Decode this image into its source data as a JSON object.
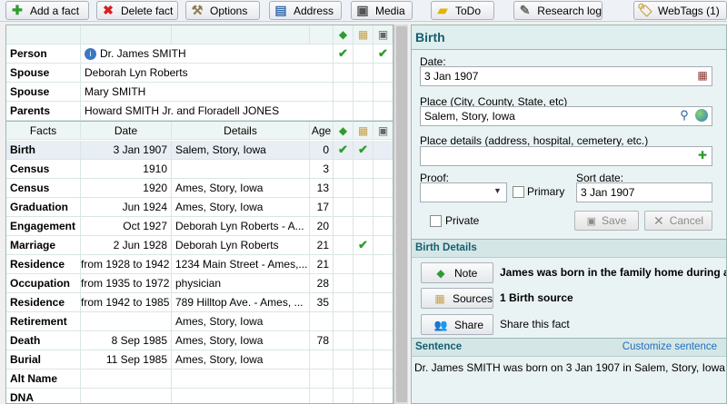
{
  "toolbar": {
    "add_fact": "Add a fact",
    "delete_fact": "Delete fact",
    "options": "Options",
    "address": "Address",
    "media": "Media",
    "todo": "ToDo",
    "research_log": "Research log",
    "webtags": "WebTags (1)"
  },
  "people": {
    "person_label": "Person",
    "person_name": "Dr. James SMITH",
    "spouse1_label": "Spouse",
    "spouse1_name": "Deborah Lyn Roberts",
    "spouse2_label": "Spouse",
    "spouse2_name": "Mary SMITH",
    "parents_label": "Parents",
    "parents_name": "Howard SMITH Jr. and Floradell JONES"
  },
  "facts_header": {
    "facts": "Facts",
    "date": "Date",
    "details": "Details",
    "age": "Age"
  },
  "facts": [
    {
      "fact": "Birth",
      "date": "3 Jan 1907",
      "details": "Salem, Story, Iowa",
      "age": "0",
      "note": true,
      "source": true
    },
    {
      "fact": "Census",
      "date": "1910",
      "details": "",
      "age": "3"
    },
    {
      "fact": "Census",
      "date": "1920",
      "details": "Ames, Story, Iowa",
      "age": "13"
    },
    {
      "fact": "Graduation",
      "date": "Jun 1924",
      "details": "Ames, Story, Iowa",
      "age": "17"
    },
    {
      "fact": "Engagement",
      "date": "Oct 1927",
      "details": "Deborah Lyn Roberts - A...",
      "age": "20"
    },
    {
      "fact": "Marriage",
      "date": "2 Jun 1928",
      "details": "Deborah Lyn Roberts",
      "age": "21",
      "source": true
    },
    {
      "fact": "Residence",
      "date": "from 1928 to 1942",
      "details": "1234 Main Street - Ames,...",
      "age": "21"
    },
    {
      "fact": "Occupation",
      "date": "from 1935 to 1972",
      "details": "physician",
      "age": "28"
    },
    {
      "fact": "Residence",
      "date": "from 1942 to 1985",
      "details": "789 Hilltop Ave. - Ames, ...",
      "age": "35"
    },
    {
      "fact": "Retirement",
      "date": "",
      "details": "Ames, Story, Iowa",
      "age": ""
    },
    {
      "fact": "Death",
      "date": "8 Sep 1985",
      "details": "Ames, Story, Iowa",
      "age": "78"
    },
    {
      "fact": "Burial",
      "date": "11 Sep 1985",
      "details": "Ames, Story, Iowa",
      "age": ""
    },
    {
      "fact": "Alt Name",
      "date": "",
      "details": "",
      "age": ""
    },
    {
      "fact": "DNA",
      "date": "",
      "details": "",
      "age": ""
    }
  ],
  "editor": {
    "title": "Birth",
    "date_label": "Date:",
    "date_value": "3 Jan 1907",
    "place_label": "Place (City, County, State, etc)",
    "place_value": "Salem, Story, Iowa",
    "place_details_label": "Place details (address, hospital, cemetery, etc.)",
    "place_details_value": "",
    "proof_label": "Proof:",
    "proof_value": "",
    "primary_label": "Primary",
    "sort_date_label": "Sort date:",
    "sort_date_value": "3 Jan 1907",
    "private_label": "Private",
    "save_label": "Save",
    "cancel_label": "Cancel"
  },
  "details": {
    "section_title": "Birth Details",
    "note_label": "Note",
    "note_text": "James was born in the family home during a",
    "sources_label": "Sources",
    "sources_text": "1 Birth source",
    "share_label": "Share",
    "share_text": "Share this fact"
  },
  "sentence": {
    "section_title": "Sentence",
    "customize_label": "Customize sentence",
    "text": "Dr. James SMITH was born on 3 Jan 1907 in Salem, Story, Iowa."
  },
  "colors": {
    "accent": "#155f6f",
    "check": "#2e9c2e",
    "link": "#1f6fbf"
  }
}
